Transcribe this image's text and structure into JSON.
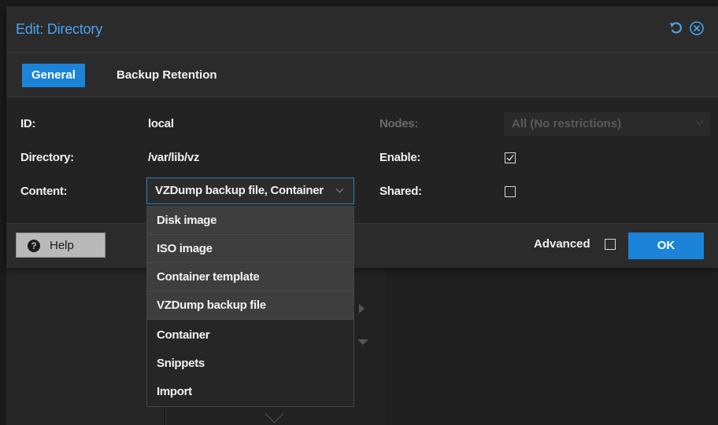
{
  "dialog": {
    "title": "Edit: Directory",
    "icons": {
      "reset": "reset-icon",
      "close": "close-circle-icon"
    },
    "accent": "#1b84d9"
  },
  "tabs": [
    {
      "label": "General",
      "active": true
    },
    {
      "label": "Backup Retention",
      "active": false
    }
  ],
  "form": {
    "id_label": "ID:",
    "id_value": "local",
    "directory_label": "Directory:",
    "directory_value": "/var/lib/vz",
    "content_label": "Content:",
    "content_value": "VZDump backup file, Container",
    "nodes_label": "Nodes:",
    "nodes_value": "All (No restrictions)",
    "enable_label": "Enable:",
    "enable_checked": true,
    "shared_label": "Shared:",
    "shared_checked": false
  },
  "footer": {
    "help_label": "Help",
    "advanced_label": "Advanced",
    "advanced_checked": false,
    "ok_label": "OK"
  },
  "content_dropdown": {
    "options": [
      "Disk image",
      "ISO image",
      "Container template",
      "VZDump backup file",
      "Container",
      "Snippets",
      "Import"
    ],
    "selected": [
      "Disk image",
      "ISO image",
      "Container template",
      "VZDump backup file"
    ]
  }
}
